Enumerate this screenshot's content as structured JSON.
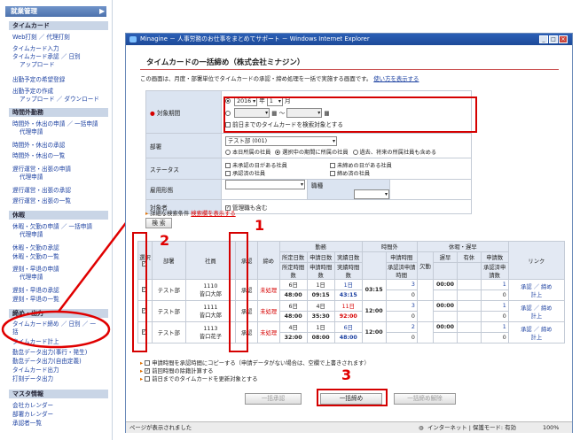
{
  "sidebar": {
    "header": "就業管理",
    "sections": [
      {
        "title": "タイムカード",
        "links": [
          "Web打刻 ／ 代理打刻",
          "タイムカード入力",
          "タイムカード承認 ／ 日別",
          "アップロード",
          "出勤予定の希望登録",
          "出勤予定の作成",
          "アップロード ／ ダウンロード"
        ]
      },
      {
        "title": "時間外勤務",
        "links": [
          "時間外・休出の申請 ／ 一括申請",
          "代理申請",
          "時間外・休出の承認",
          "時間外・休出の一覧",
          "遅行運営・出張の申請",
          "代理申請",
          "遅行運営・出張の承認",
          "遅行運営・出張の一覧"
        ]
      },
      {
        "title": "休暇",
        "links": [
          "休暇・欠勤の申請 ／ 一括申請",
          "代理申請",
          "休暇・欠勤の承認",
          "休暇・欠勤の一覧",
          "遅刻・早退の申請",
          "代理申請",
          "遅刻・早退の承認",
          "遅刻・早退の一覧"
        ]
      },
      {
        "title": "締め・出力",
        "links": [
          "タイムカード締め ／ 日別 ／ 一括",
          "タイムカード計上",
          "勤怠データ出力(事行・発生)",
          "勤怠データ出力(自由定義)",
          "タイムカード出力",
          "打刻データ出力"
        ]
      },
      {
        "title": "マスタ情報",
        "links": [
          "会社カレンダー",
          "部署カレンダー",
          "承認者一覧"
        ]
      }
    ]
  },
  "window": {
    "title": "Minagine － 人事労務のお仕事をまとめてサポート － Windows Internet Explorer",
    "status_left": "ページが表示されました",
    "status_zone": "インターネット | 保護モード: 有効",
    "zoom": "100%"
  },
  "page": {
    "heading": "タイムカードの一括締め（株式会社ミナジン）",
    "description": "この画面は、月度・部署単位でタイムカードの承認・締め処理を一括で実施する画面です。",
    "howto_link": "使い方を表示する",
    "form": {
      "period_label": "対象期間",
      "year": "2016",
      "year_unit": "年",
      "month": "1",
      "month_unit": "月",
      "range_sep": "～",
      "prev_day_option": "前日までのタイムカードを検索対象とする",
      "dept_label": "部署",
      "dept_value": "テスト部 (001)",
      "dept_scope": [
        "本日所属の社員",
        "選択中の期間に所属の社員",
        "過去、将来の所属社員も含める"
      ],
      "status_label": "ステータス",
      "status_options": [
        "未承認の日がある社員",
        "未締めの日がある社員",
        "承認済の社員",
        "締め済の社員"
      ],
      "employment_label": "雇用形態",
      "position_label": "職種",
      "target_label": "対象者",
      "target_option": "管理職も含む",
      "search_link_prefix": "詳細な検索条件",
      "search_link": "検索欄を表示する",
      "search_button": "検 索"
    },
    "table": {
      "h_select": "選択",
      "h_dept": "部署",
      "h_emp": "社員",
      "h_approve": "承認",
      "h_close": "締め",
      "h_work": "勤務",
      "h_scheduled": "所定日数",
      "h_applied_days": "申請日数",
      "h_actual_days": "実績日数",
      "h_sched_hours": "所定時間数",
      "h_applied_hours": "申請時間数",
      "h_actual_hours": "実績時間数",
      "h_overtime": "時間外",
      "h_ot_applied": "申請時間",
      "h_ot_approved": "承認済申請時間",
      "h_leave": "休暇・遅早",
      "h_absence": "欠勤",
      "h_late": "遅早",
      "h_paid": "有休",
      "h_leave_applied": "申請数",
      "h_leave_approved": "承認済申請数",
      "h_link": "リンク",
      "rows": [
        {
          "dept": "テスト部",
          "code": "1110",
          "name": "皆口大郎",
          "approve": "承認",
          "close": "未処理",
          "sched_days": "6日",
          "applied_days": "1日",
          "actual_days": "1日",
          "sched_hours": "48:00",
          "applied_hours": "09:15",
          "actual_hours": "43:15",
          "ot": "03:15",
          "ot_applied": "3",
          "ot_approved": "0",
          "late": "00:00",
          "leave_applied": "1",
          "leave_approved": "0",
          "links": "承認 ／ 締め",
          "links2": "計上"
        },
        {
          "dept": "テスト部",
          "code": "1111",
          "name": "皆口大郎",
          "approve": "承認",
          "close": "未処理",
          "sched_days": "6日",
          "applied_days": "4日",
          "actual_days": "11日",
          "sched_hours": "48:00",
          "applied_hours": "35:30",
          "actual_hours": "92:00",
          "ot": "12:00",
          "ot_applied": "3",
          "ot_approved": "0",
          "late": "00:00",
          "leave_applied": "1",
          "leave_approved": "0",
          "links": "承認 ／ 締め",
          "links2": "計上"
        },
        {
          "dept": "テスト部",
          "code": "1113",
          "name": "皆口花子",
          "approve": "承認",
          "close": "未処理",
          "sched_days": "4日",
          "applied_days": "1日",
          "actual_days": "6日",
          "sched_hours": "32:00",
          "applied_hours": "08:00",
          "actual_hours": "48:00",
          "ot": "12:00",
          "ot_applied": "2",
          "ot_approved": "0",
          "late": "00:00",
          "leave_applied": "1",
          "leave_approved": "0",
          "links": "承認 ／ 締め",
          "links2": "計上"
        }
      ]
    },
    "options": [
      "申請時間を承認時間にコピーする（申請データがない場合は、空欄で上書きされます）",
      "前回時間の除籍計算する",
      "前日までのタイムカードを更新対象とする"
    ],
    "buttons": {
      "bulk_approve": "一括承認",
      "bulk_close": "一括締め",
      "bulk_release": "一括締め解除"
    },
    "callouts": [
      "1",
      "2",
      "3"
    ]
  }
}
